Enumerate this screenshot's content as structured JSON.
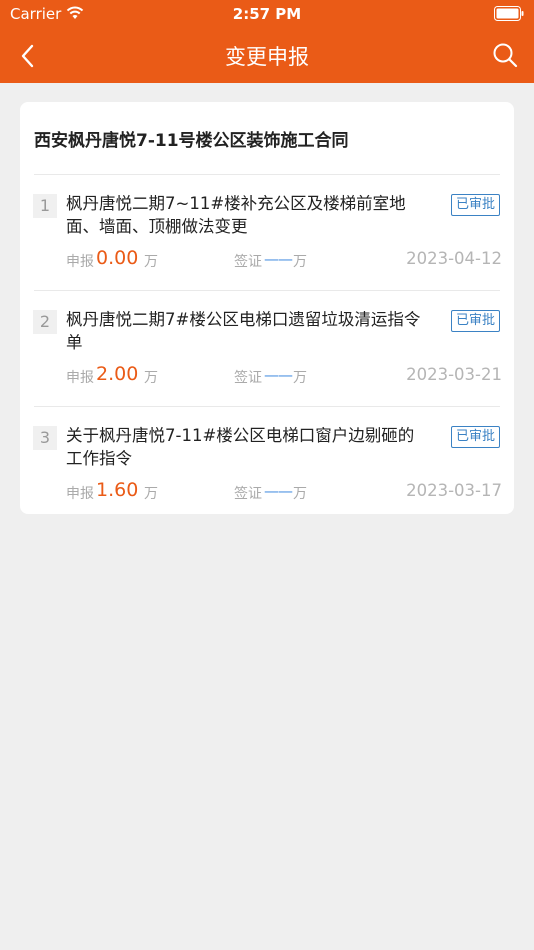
{
  "status_bar": {
    "carrier": "Carrier",
    "time": "2:57 PM"
  },
  "nav": {
    "title": "变更申报"
  },
  "contract": {
    "title": "西安枫丹唐悦7-11号楼公区装饰施工合同"
  },
  "labels": {
    "apply": "申报",
    "visa": "签证",
    "unit": "万",
    "visa_empty": "——"
  },
  "items": [
    {
      "index": "1",
      "name": "枫丹唐悦二期7~11#楼补充公区及楼梯前室地面、墙面、顶棚做法变更",
      "status": "已审批",
      "amount": "0.00",
      "date": "2023-04-12"
    },
    {
      "index": "2",
      "name": "枫丹唐悦二期7#楼公区电梯口遗留垃圾清运指令单",
      "status": "已审批",
      "amount": "2.00",
      "date": "2023-03-21"
    },
    {
      "index": "3",
      "name": "关于枫丹唐悦7-11#楼公区电梯口窗户边剔砸的工作指令",
      "status": "已审批",
      "amount": "1.60",
      "date": "2023-03-17"
    }
  ],
  "colors": {
    "brand": "#ea5b17",
    "badge": "#3b82c4",
    "visa": "#4a90e2"
  }
}
